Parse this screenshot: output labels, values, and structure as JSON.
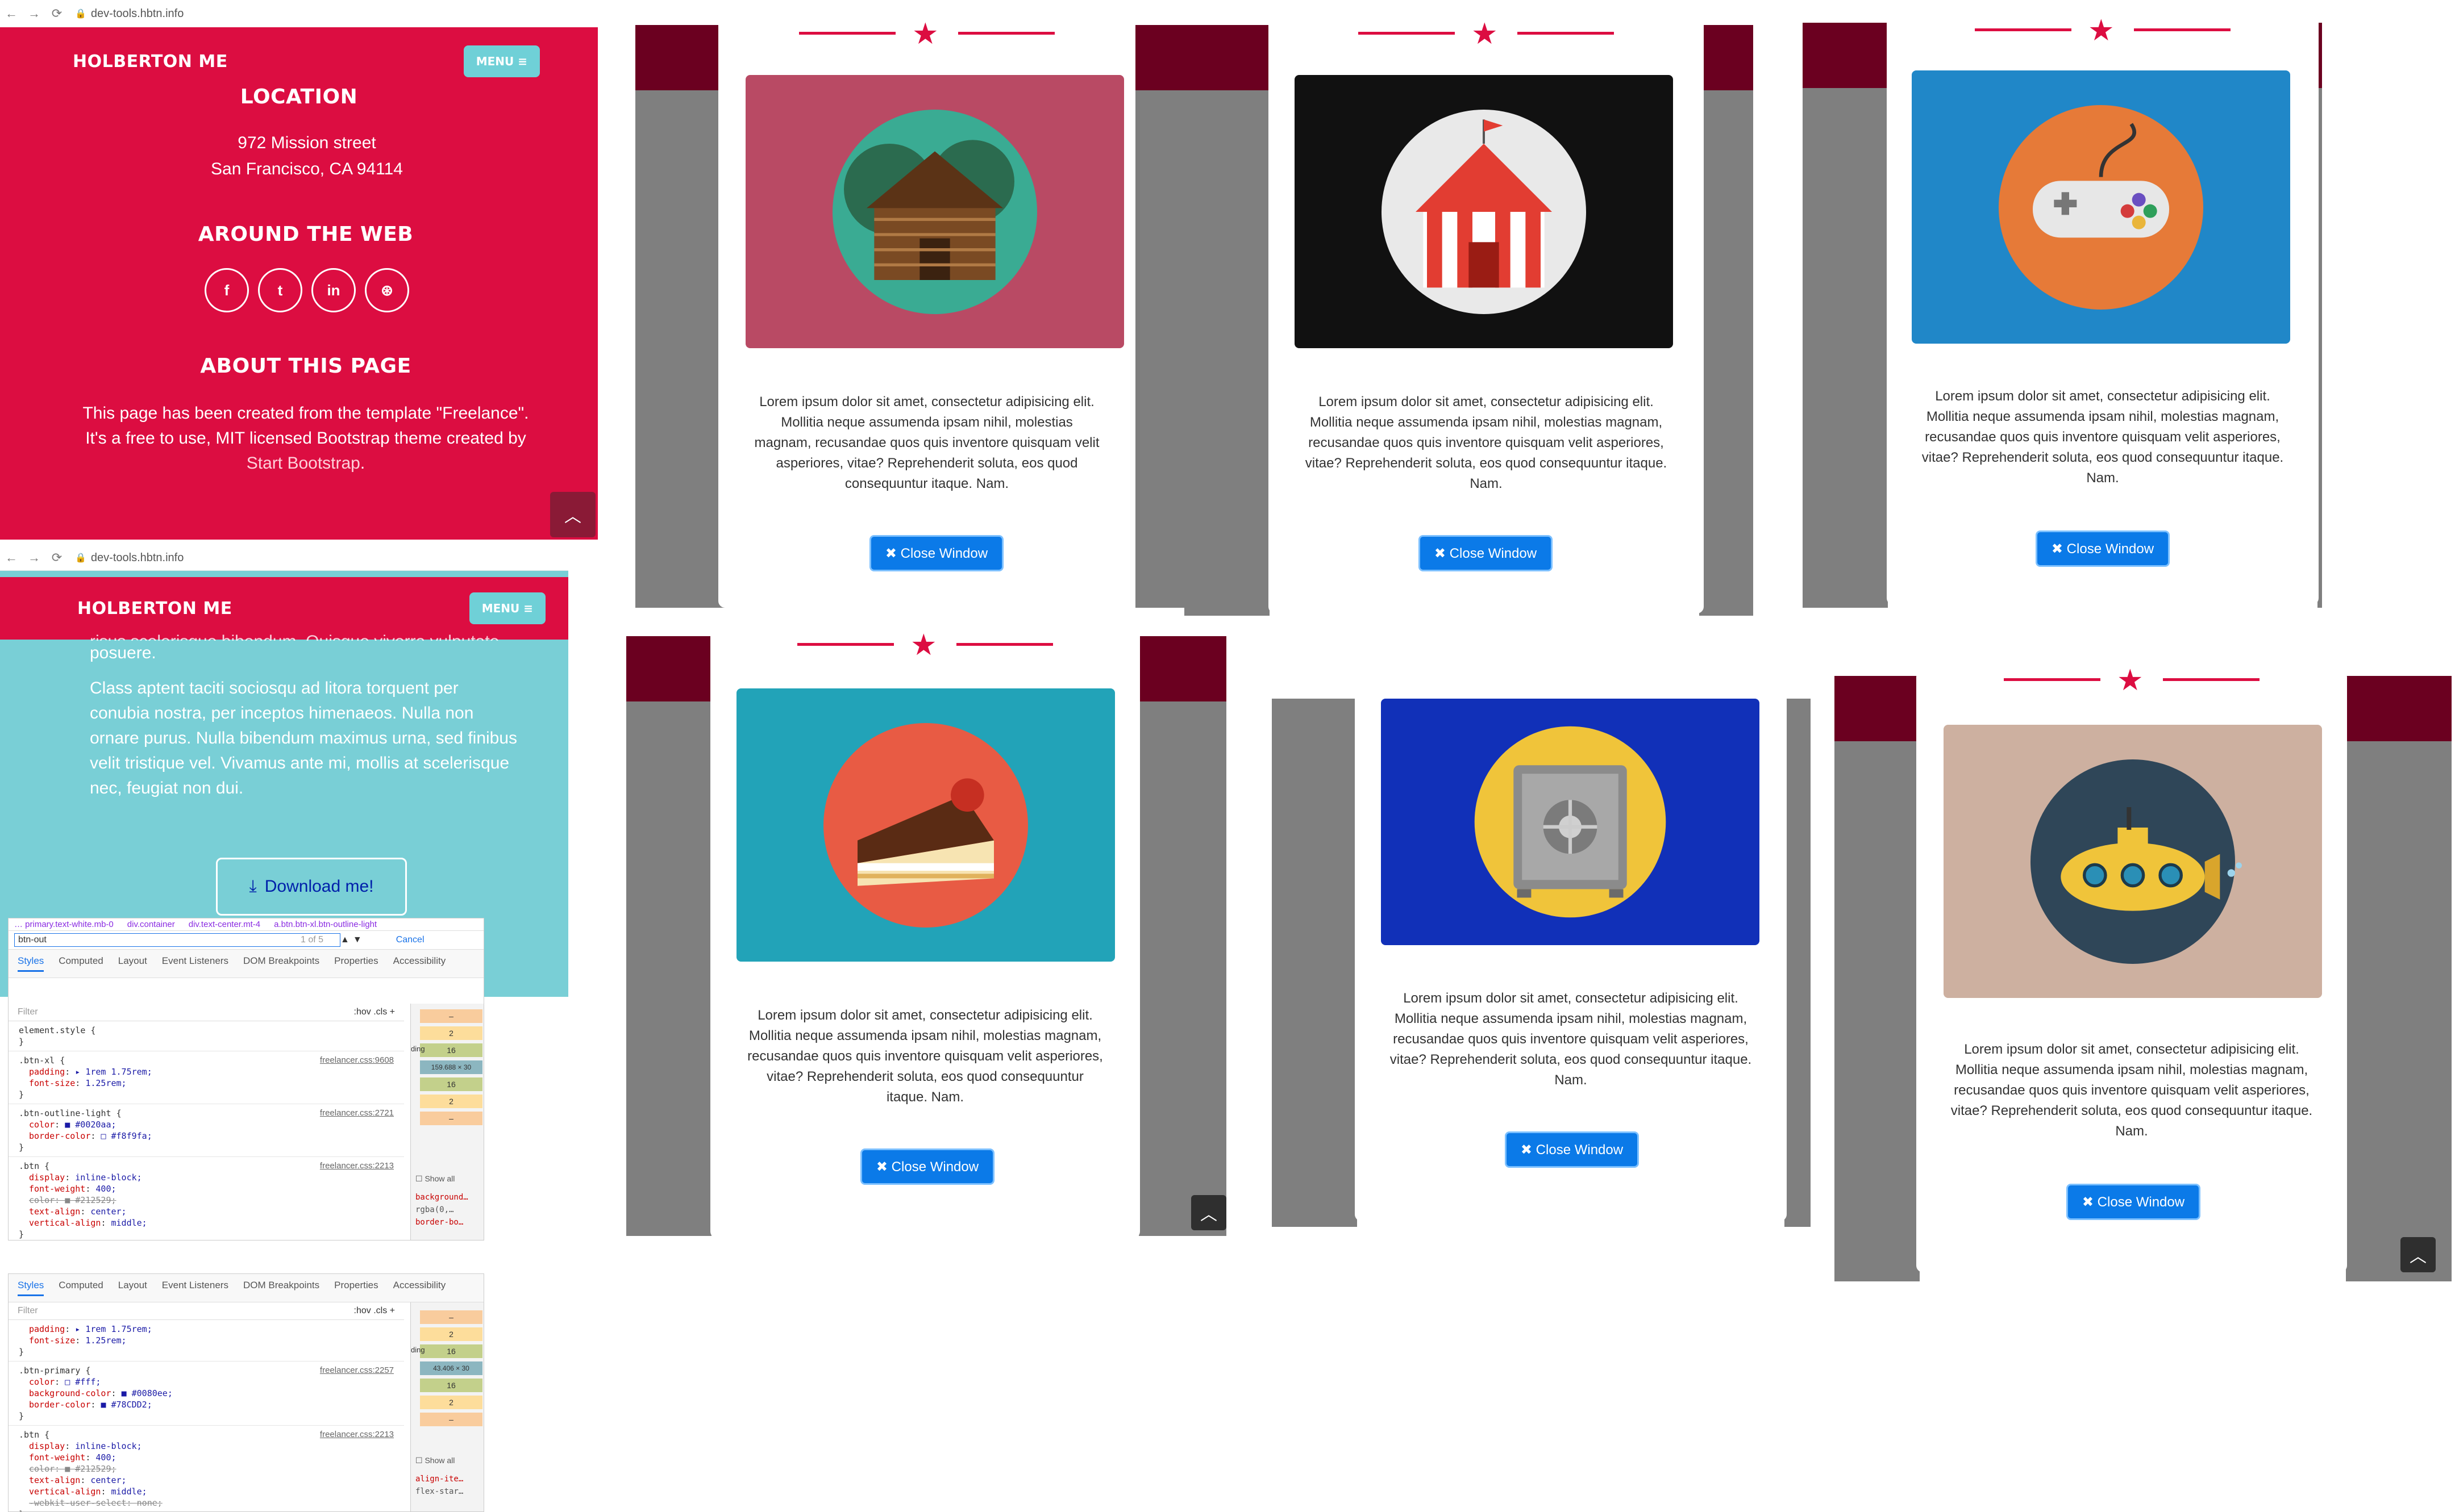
{
  "browser": {
    "url": "dev-tools.hbtn.info"
  },
  "site": {
    "brand": "HOLBERTON ME",
    "menu_label": "MENU ≡",
    "footer": {
      "location_heading": "LOCATION",
      "address_line1": "972 Mission street",
      "address_line2": "San Francisco, CA 94114",
      "web_heading": "AROUND THE WEB",
      "social": [
        "f",
        "t",
        "in",
        "⊛"
      ],
      "about_heading": "ABOUT THIS PAGE",
      "about_text1": "This page has been created from the template \"Freelance\".",
      "about_text2": "It's a free to use, MIT licensed Bootstrap theme created by",
      "about_link": "Start Bootstrap",
      "about_end": "."
    },
    "about_section": {
      "partial_line1": "risus scelerisque bibendum. Quisque viverra vulputate",
      "partial_line2": "posuere.",
      "paragraph": "Class aptent taciti sociosqu ad litora torquent per conubia nostra, per inceptos himenaeos. Nulla non ornare purus. Nulla bibendum maximus urna, sed finibus velit tristique vel. Vivamus ante mi, mollis at scelerisque nec, feugiat non dui.",
      "download_label": "Download me!"
    }
  },
  "devtools1": {
    "breadcrumb": [
      "… primary.text-white.mb-0",
      "div.container",
      "div.text-center.mt-4",
      "a.btn.btn-xl.btn-outline-light"
    ],
    "search_value": "btn-out",
    "search_count": "1 of 5",
    "cancel": "Cancel",
    "tabs": [
      "Styles",
      "Computed",
      "Layout",
      "Event Listeners",
      "DOM Breakpoints",
      "Properties",
      "Accessibility"
    ],
    "filter_placeholder": "Filter",
    "filter_tools": ":hov  .cls  +",
    "rules": [
      {
        "selector": "element.style {",
        "source": "",
        "props": []
      },
      {
        "selector": ".btn-xl {",
        "source": "freelancer.css:9608",
        "props": [
          [
            "padding",
            "▸ 1rem 1.75rem;"
          ],
          [
            "font-size",
            "1.25rem;"
          ]
        ]
      },
      {
        "selector": ".btn-outline-light {",
        "source": "freelancer.css:2721",
        "props": [
          [
            "color",
            "■ #0020aa;"
          ],
          [
            "border-color",
            "□ #f8f9fa;"
          ]
        ]
      },
      {
        "selector": ".btn {",
        "source": "freelancer.css:2213",
        "props": [
          [
            "display",
            "inline-block;"
          ],
          [
            "font-weight",
            "400;"
          ],
          [
            "color",
            "■ #212529;"
          ],
          [
            "text-align",
            "center;"
          ],
          [
            "vertical-align",
            "middle;"
          ]
        ]
      }
    ],
    "boxmodel": [
      "–",
      "2",
      "16",
      "159.688 × 30",
      "16",
      "2",
      "–"
    ],
    "boxmodel_label": "ding",
    "show_all": "Show all",
    "computed": [
      "background…",
      "rgba(0,…",
      "border-bo…"
    ]
  },
  "devtools2": {
    "tabs": [
      "Styles",
      "Computed",
      "Layout",
      "Event Listeners",
      "DOM Breakpoints",
      "Properties",
      "Accessibility"
    ],
    "filter_placeholder": "Filter",
    "filter_tools": ":hov  .cls  +",
    "rules": [
      {
        "selector": "",
        "source": "",
        "props": [
          [
            "padding",
            "▸ 1rem 1.75rem;"
          ],
          [
            "font-size",
            "1.25rem;"
          ]
        ]
      },
      {
        "selector": ".btn-primary {",
        "source": "freelancer.css:2257",
        "props": [
          [
            "color",
            "□ #fff;"
          ],
          [
            "background-color",
            "■ #0080ee;"
          ],
          [
            "border-color",
            "■ #78CDD2;"
          ]
        ]
      },
      {
        "selector": ".btn {",
        "source": "freelancer.css:2213",
        "props": [
          [
            "display",
            "inline-block;"
          ],
          [
            "font-weight",
            "400;"
          ],
          [
            "color",
            "■ #212529;"
          ],
          [
            "text-align",
            "center;"
          ],
          [
            "vertical-align",
            "middle;"
          ],
          [
            "-webkit-user-select",
            "none;"
          ]
        ]
      }
    ],
    "boxmodel": [
      "–",
      "2",
      "16",
      "43.406 × 30",
      "16",
      "2",
      "–"
    ],
    "boxmodel_label": "ding",
    "show_all": "Show all",
    "computed": [
      "align-ite…",
      "flex-star…"
    ]
  },
  "modals": {
    "lorem": "Lorem ipsum dolor sit amet, consectetur adipisicing elit. Mollitia neque assumenda ipsam nihil, molestias magnam, recusandae quos quis inventore quisquam velit asperiores, vitae? Reprehenderit soluta, eos quod consequuntur itaque. Nam.",
    "close_label": "✖ Close Window",
    "items": [
      {
        "name": "cabin",
        "bg": "#b94a64"
      },
      {
        "name": "circus",
        "bg": "#111111"
      },
      {
        "name": "game",
        "bg": "#2087c8"
      },
      {
        "name": "cake",
        "bg": "#22a3b8"
      },
      {
        "name": "safe",
        "bg": "#1130b8"
      },
      {
        "name": "submarine",
        "bg": "#cdb0a0"
      }
    ]
  },
  "colors": {
    "brand_red": "#dc0d41",
    "teal": "#6fd0d7",
    "primary": "#0b7ae8"
  }
}
